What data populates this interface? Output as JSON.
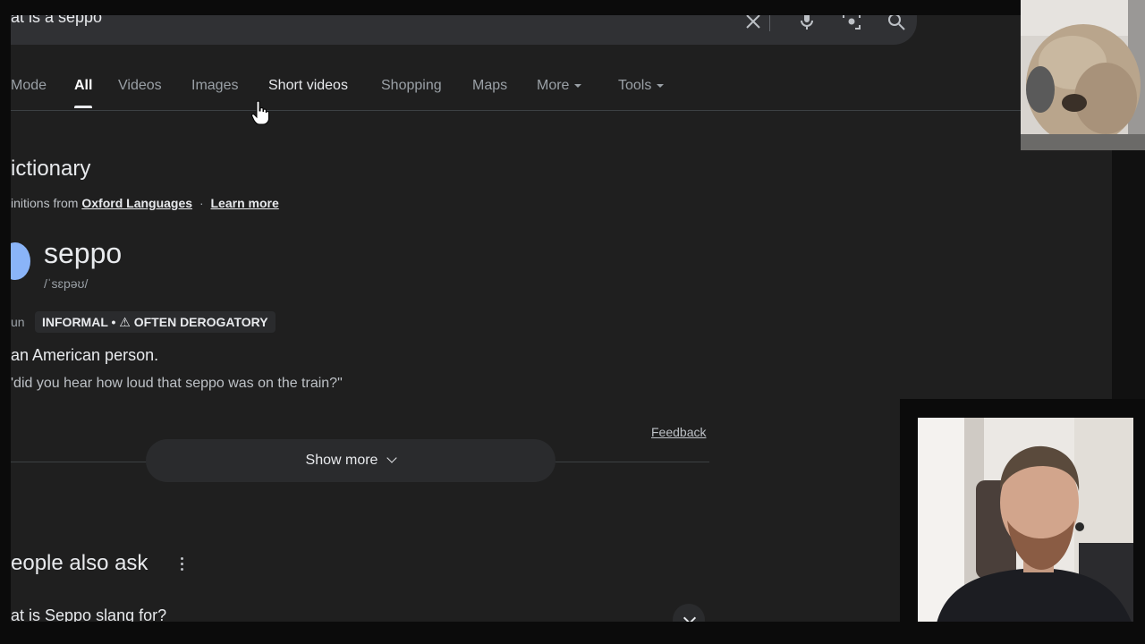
{
  "search": {
    "query": "at is a seppo"
  },
  "tabs": [
    {
      "label": "Mode"
    },
    {
      "label": "All"
    },
    {
      "label": "Videos"
    },
    {
      "label": "Images"
    },
    {
      "label": "Short videos"
    },
    {
      "label": "Shopping"
    },
    {
      "label": "Maps"
    },
    {
      "label": "More"
    },
    {
      "label": "Tools"
    }
  ],
  "dictionary": {
    "heading": "ictionary",
    "defs_prefix": "initions from",
    "source_link": "Oxford Languages",
    "separator": "·",
    "learn_more": "Learn more",
    "word": "seppo",
    "phonetic": "/ˈsɛpəʊ/",
    "part_of_speech": "un",
    "labels": "INFORMAL • ⚠ OFTEN DEROGATORY",
    "definition": "an American person.",
    "example": "'did you hear how loud that seppo was on the train?\"",
    "feedback": "Feedback",
    "show_more": "Show more"
  },
  "people_also_ask": {
    "heading": "eople also ask",
    "question": "at is Seppo slang for?"
  },
  "colors": {
    "background": "#1f1f1f",
    "accent_blue": "#8ab4f8",
    "text": "#e8eaed"
  }
}
